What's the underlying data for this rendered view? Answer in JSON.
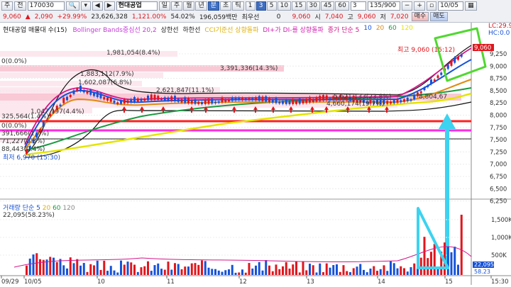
{
  "toolbar": {
    "menu_label": "주",
    "mode_label": "전",
    "code_value": "170030",
    "stock_name": "현대공업",
    "period_tabs": [
      "일",
      "주",
      "월",
      "년",
      "분",
      "초",
      "틱"
    ],
    "minute_tabs": [
      "1",
      "3",
      "5",
      "10",
      "15",
      "30",
      "45",
      "60"
    ],
    "active_tab": "3",
    "interval_value": "3",
    "count_value": "135/900",
    "date_value": "10/05",
    "price": "9,060",
    "change": "2,090",
    "change_pct": "+29.99%",
    "volume": "23,626,328",
    "volume_pct": "1,121.00%",
    "ratio": "54.02%",
    "amount": "196,059백만",
    "hilo_label": "최우선",
    "zero": "0",
    "bid": "9,060",
    "open_label": "시",
    "open": "7,040",
    "high_label": "고",
    "high": "9,060",
    "low_label": "저",
    "low": "7,020",
    "buy_button": "매수",
    "sell_button": "매도"
  },
  "legend": {
    "title": "현대공업 매물대 수(15)",
    "items": [
      {
        "label": "Bollinger Bands중심선 20,2",
        "color": "#c43dd8"
      },
      {
        "label": "상한선",
        "color": "#222222"
      },
      {
        "label": "하한선",
        "color": "#222222"
      },
      {
        "label": "CCI기준선 상향돌파",
        "color": "#e0b000"
      },
      {
        "label": "DI+가 DI-를 상향돌파",
        "color": "#d01fb0"
      },
      {
        "label": "종가 단순 5",
        "color": "#d4168a"
      },
      {
        "label": "10",
        "color": "#1652d8"
      },
      {
        "label": "20",
        "color": "#e08a10"
      },
      {
        "label": "60",
        "color": "#1a9a40"
      },
      {
        "label": "120",
        "color": "#e4e400"
      }
    ],
    "corner_lc": "LC:29.9",
    "corner_hc": "HC:0.0"
  },
  "price_axis": [
    "9,250",
    "9,000",
    "8,750",
    "8,500",
    "8,250",
    "8,000",
    "7,750",
    "7,500",
    "7,250",
    "7,000",
    "6,750",
    "6,500",
    "6,250"
  ],
  "volume_axis": [
    "1,500K",
    "1,000K",
    "500K"
  ],
  "volume_badges": {
    "blue": "22,095",
    "red": "58.23"
  },
  "time_axis": [
    "09/29",
    "10/05",
    "10",
    "11",
    "12",
    "13",
    "14",
    "15",
    "15:30"
  ],
  "annotations": {
    "high_label": "최고 9,060 (15:12)",
    "low_label": "최저 6,970 (15:30)",
    "zero_label_1": "0(0.0%)",
    "zero_label_2": "0(0.0%)",
    "vp1": "1,981,054(8.4%)",
    "vp2": "3,391,336(14.3%)",
    "vp3": "1,883,112(7.9%)",
    "vp4": "1,602,087(6.8%)",
    "vp5": "2,621,847(11.1%)",
    "vp6": "1,047,197(4.4%)",
    "vp7": "5,621,133(23.8%)",
    "vp8": "4,660,174(19.7%)",
    "vp9": "325,564(1.4%)",
    "vp10": "391,666(1.7%)",
    "vp11": "71,227(0.3%)",
    "vp12": "88,443(0.4%)",
    "vp13": "8,804,67"
  },
  "volume_legend": {
    "label": "거래량 단순 5",
    "periods": [
      "20",
      "60",
      "120"
    ],
    "value": "22,095(58.23%)"
  },
  "colors": {
    "up": "#e0161d",
    "down": "#1652d8",
    "ma5": "#d4168a",
    "ma10": "#1652d8",
    "ma20": "#e08a10",
    "ma60": "#1a9a40",
    "ma120": "#e4e400",
    "highlight": "#3cd3f0",
    "green_box": "#50d830"
  }
}
